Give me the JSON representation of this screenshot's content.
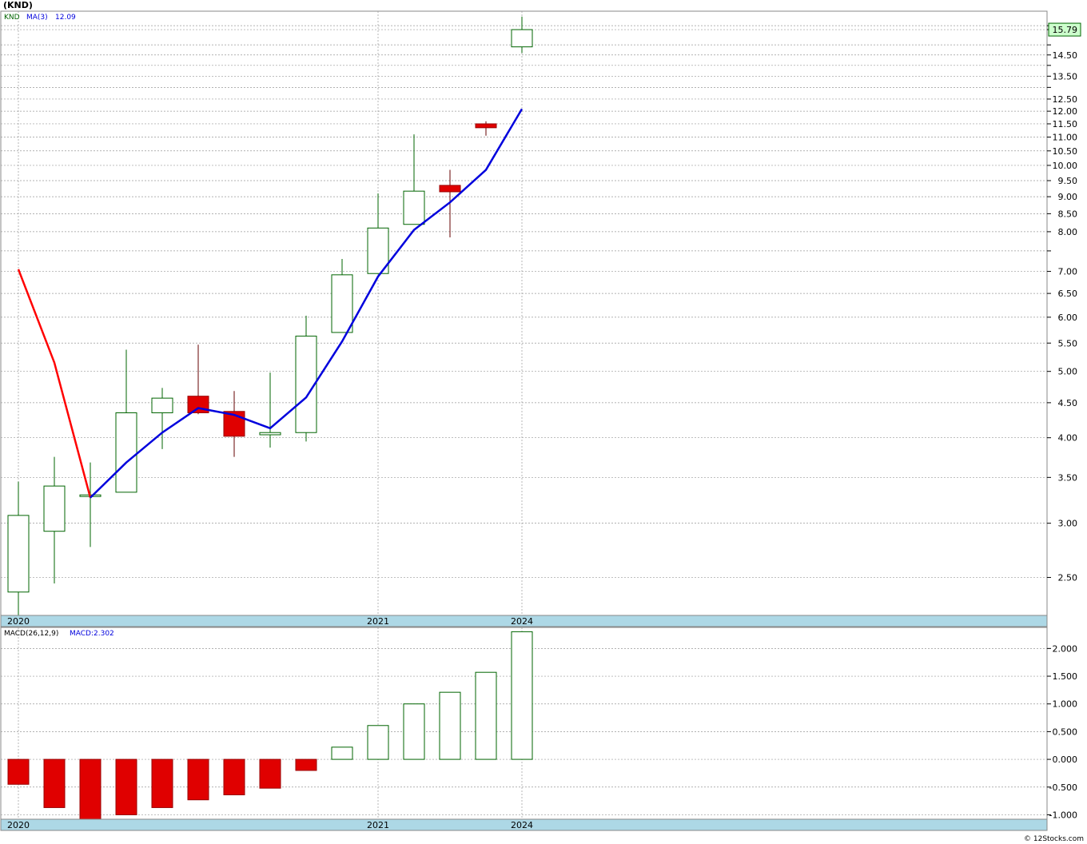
{
  "title": "(KND)",
  "credit": "© 12Stocks.com",
  "colors": {
    "up": "#006400",
    "down": "#e00000",
    "ma_before": "#ff0000",
    "ma_after": "#0000dd",
    "grid": "#999999",
    "axis_band": "#add8e6",
    "last_bg": "#ccffcc"
  },
  "chart_data": [
    {
      "type": "candlestick",
      "name": "price",
      "symbol": "KND",
      "legend": {
        "symbol": "KND",
        "ma_label": "MA(3)",
        "ma_value": "12.09"
      },
      "last_price_label": "15.79",
      "y_scale": "log",
      "ylim": [
        2.2,
        16.8
      ],
      "yticks": [
        {
          "v": 15.79,
          "t": "15.79"
        },
        {
          "v": 14.5,
          "t": "14.50"
        },
        {
          "v": 13.5,
          "t": "13.50"
        },
        {
          "v": 12.5,
          "t": "12.50"
        },
        {
          "v": 12.0,
          "t": "12.00"
        },
        {
          "v": 11.5,
          "t": "11.50"
        },
        {
          "v": 11.0,
          "t": "11.00"
        },
        {
          "v": 10.5,
          "t": "10.50"
        },
        {
          "v": 10.0,
          "t": "10.00"
        },
        {
          "v": 9.5,
          "t": "9.50"
        },
        {
          "v": 9.0,
          "t": "9.00"
        },
        {
          "v": 8.5,
          "t": "8.50"
        },
        {
          "v": 8.0,
          "t": "8.00"
        },
        {
          "v": 7.0,
          "t": "7.00"
        },
        {
          "v": 6.5,
          "t": "6.50"
        },
        {
          "v": 6.0,
          "t": "6.00"
        },
        {
          "v": 5.5,
          "t": "5.50"
        },
        {
          "v": 5.0,
          "t": "5.00"
        },
        {
          "v": 4.5,
          "t": "4.50"
        },
        {
          "v": 4.0,
          "t": "4.00"
        },
        {
          "v": 3.5,
          "t": "3.50"
        },
        {
          "v": 3.0,
          "t": "3.00"
        },
        {
          "v": 2.5,
          "t": "2.50"
        }
      ],
      "grid_extra": [
        16.0,
        15.0,
        14.0,
        13.0,
        7.5
      ],
      "x_labels": [
        {
          "i": 0,
          "t": "2020"
        },
        {
          "i": 10,
          "t": "2021"
        },
        {
          "i": 14,
          "t": "2024"
        }
      ],
      "candles": [
        {
          "o": 2.38,
          "h": 3.45,
          "l": 2.2,
          "c": 3.08
        },
        {
          "o": 2.92,
          "h": 3.75,
          "l": 2.45,
          "c": 3.4
        },
        {
          "o": 3.3,
          "h": 3.68,
          "l": 2.77,
          "c": 3.3
        },
        {
          "o": 3.33,
          "h": 5.38,
          "l": 3.33,
          "c": 4.35
        },
        {
          "o": 4.35,
          "h": 4.73,
          "l": 3.85,
          "c": 4.57
        },
        {
          "o": 4.6,
          "h": 5.47,
          "l": 4.33,
          "c": 4.35
        },
        {
          "o": 4.37,
          "h": 4.68,
          "l": 3.75,
          "c": 4.02
        },
        {
          "o": 4.04,
          "h": 4.98,
          "l": 3.87,
          "c": 4.07
        },
        {
          "o": 4.07,
          "h": 6.03,
          "l": 3.95,
          "c": 5.63
        },
        {
          "o": 5.7,
          "h": 7.3,
          "l": 5.7,
          "c": 6.92
        },
        {
          "o": 6.95,
          "h": 9.1,
          "l": 6.95,
          "c": 8.1
        },
        {
          "o": 8.2,
          "h": 11.1,
          "l": 8.2,
          "c": 9.17
        },
        {
          "o": 9.35,
          "h": 9.85,
          "l": 7.85,
          "c": 9.15
        },
        {
          "o": 11.5,
          "h": 11.6,
          "l": 11.05,
          "c": 11.35
        },
        {
          "o": 14.9,
          "h": 16.5,
          "l": 14.6,
          "c": 15.79
        }
      ],
      "ma": [
        7.05,
        5.15,
        3.27,
        3.68,
        4.07,
        4.42,
        4.32,
        4.13,
        4.58,
        5.53,
        6.88,
        8.05,
        8.83,
        9.85,
        12.09
      ],
      "ma_cross_index": 2
    },
    {
      "type": "bar",
      "name": "MACD(26,12,9)",
      "legend": {
        "label": "MACD(26,12,9)",
        "value_label": "MACD:2.302"
      },
      "ylim": [
        -1.08,
        2.38
      ],
      "yticks": [
        {
          "v": 2.0,
          "t": "2.000"
        },
        {
          "v": 1.5,
          "t": "1.500"
        },
        {
          "v": 1.0,
          "t": "1.000"
        },
        {
          "v": 0.5,
          "t": "0.500"
        },
        {
          "v": 0.0,
          "t": "0.000"
        },
        {
          "v": -0.5,
          "t": "-0.500"
        },
        {
          "v": -1.0,
          "t": "-1.000"
        }
      ],
      "x_labels": [
        {
          "i": 0,
          "t": "2020"
        },
        {
          "i": 10,
          "t": "2021"
        },
        {
          "i": 14,
          "t": "2024"
        }
      ],
      "values": [
        -0.45,
        -0.87,
        -1.08,
        -1.0,
        -0.87,
        -0.73,
        -0.64,
        -0.52,
        -0.2,
        0.22,
        0.61,
        1.0,
        1.21,
        1.57,
        2.302
      ]
    }
  ]
}
